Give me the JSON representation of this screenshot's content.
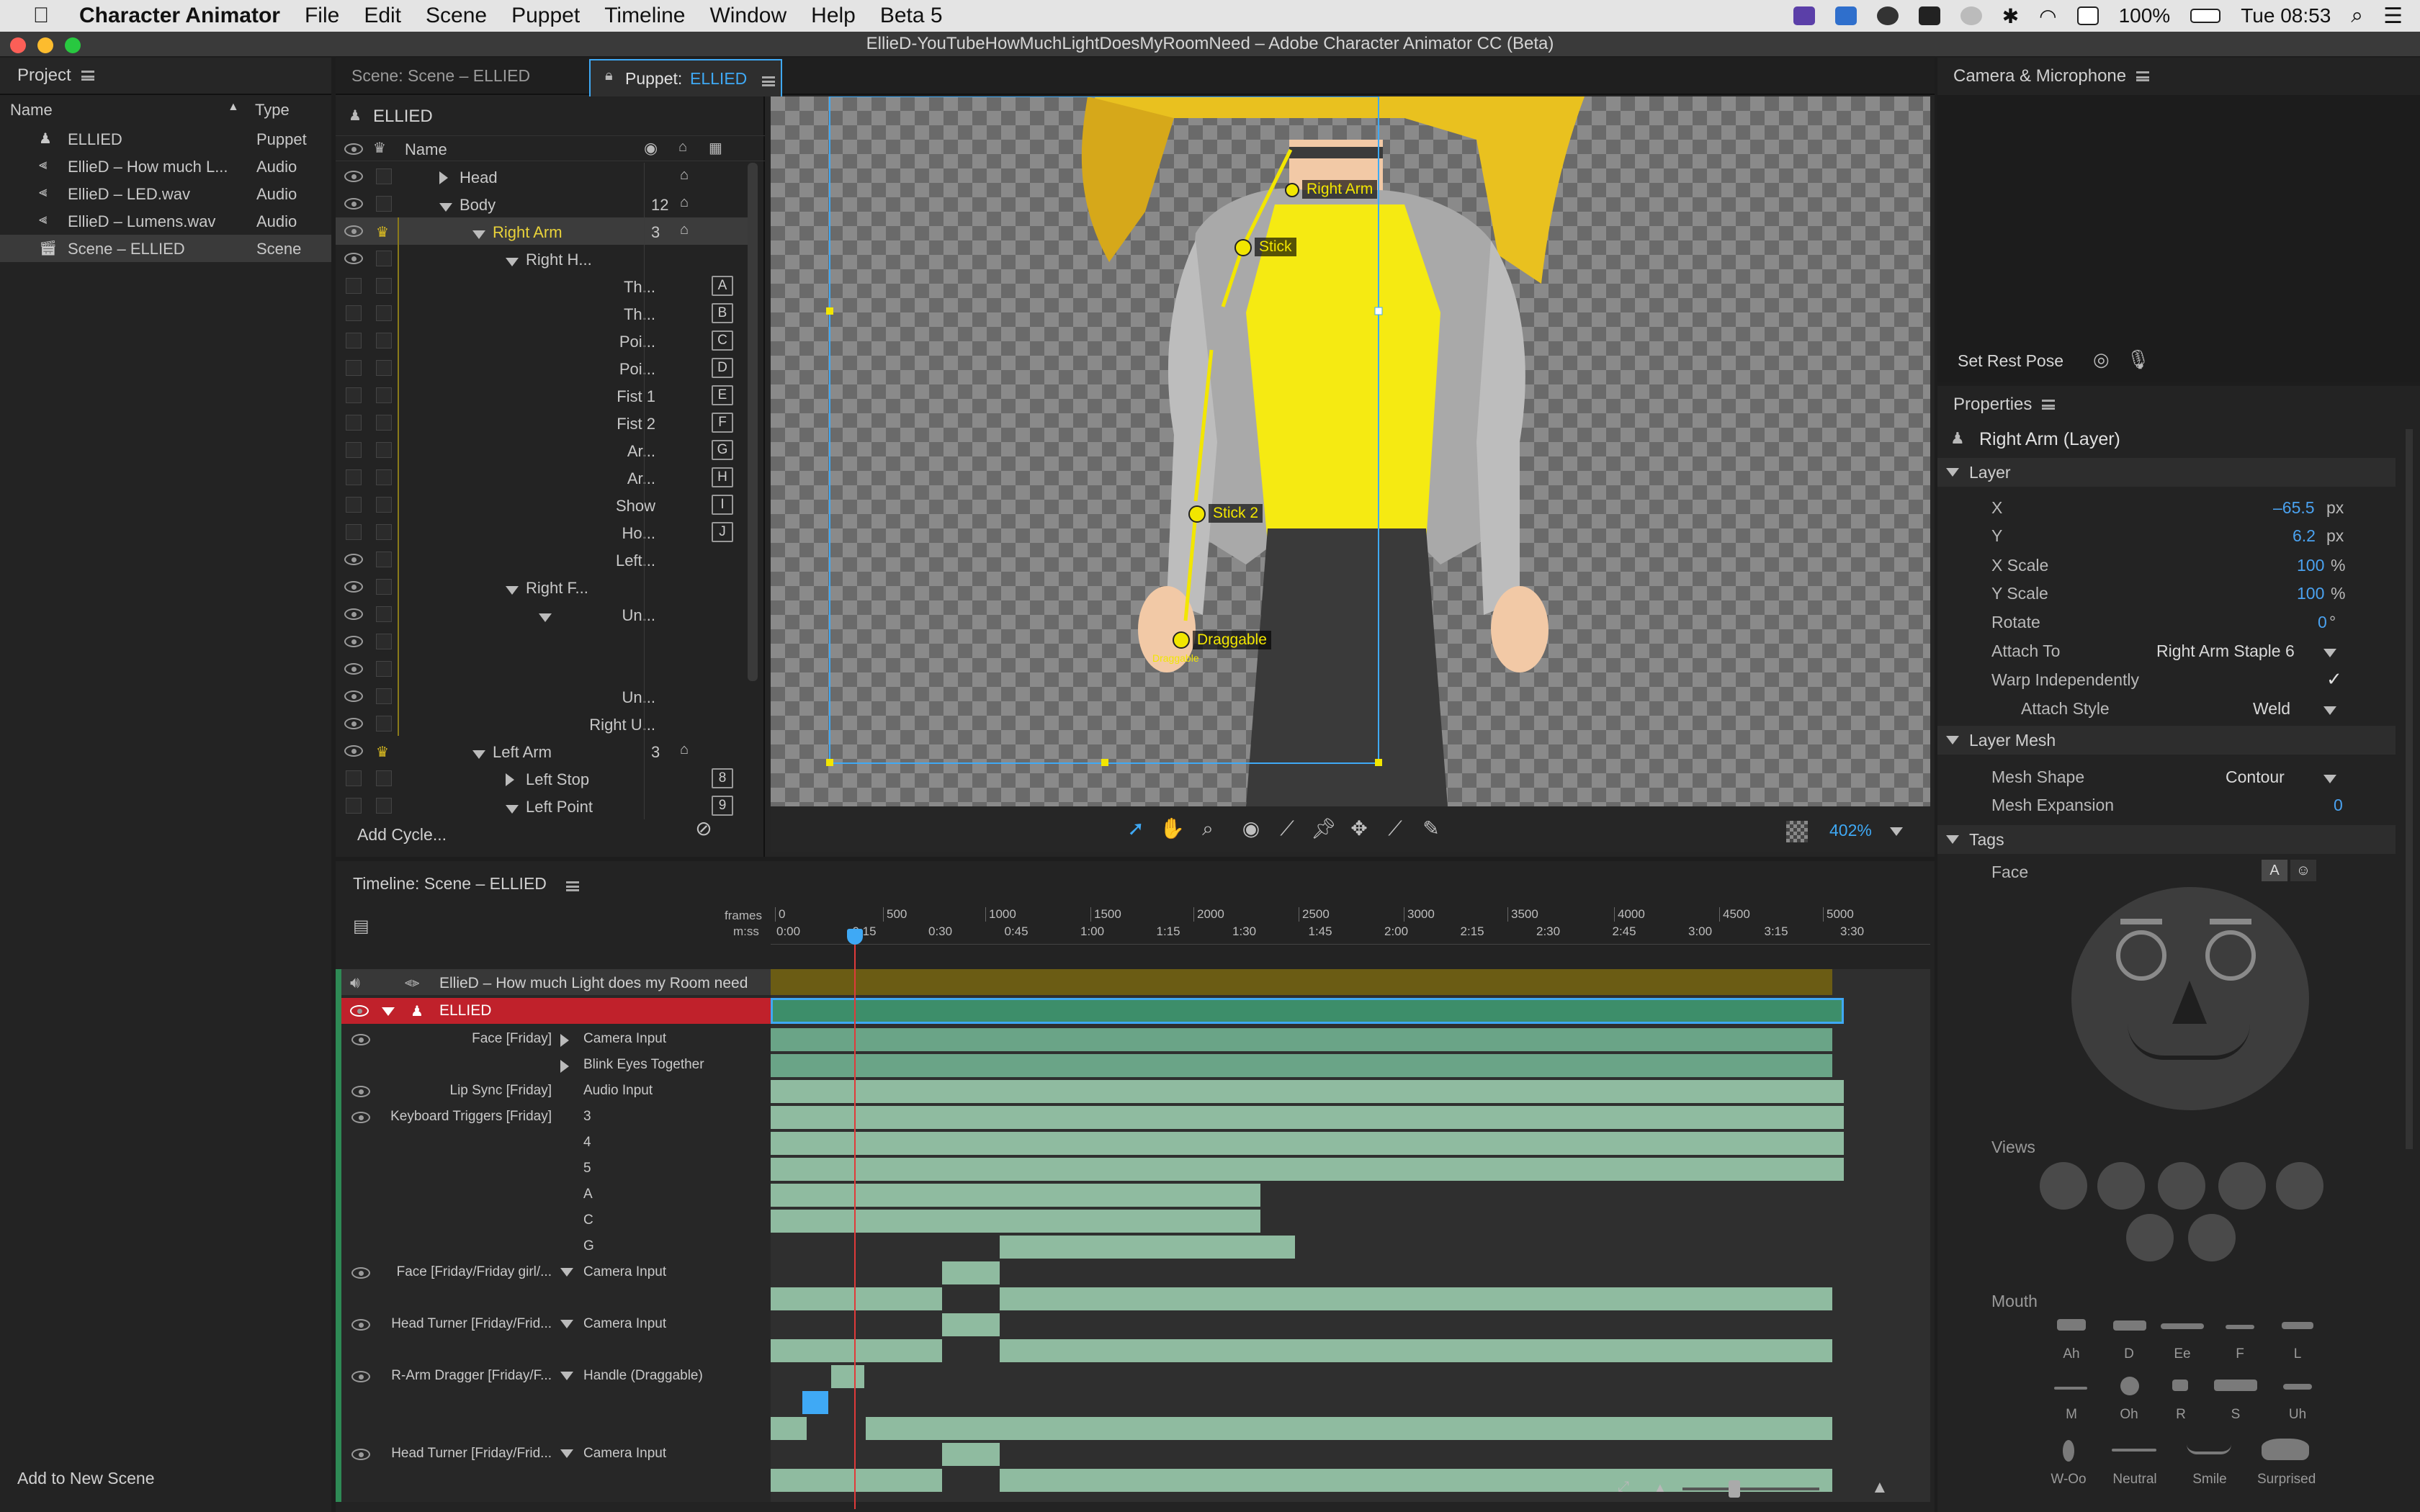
{
  "menubar": {
    "app_name": "Character Animator",
    "items": [
      "File",
      "Edit",
      "Scene",
      "Puppet",
      "Timeline",
      "Window",
      "Help",
      "Beta 5"
    ],
    "battery": "100%",
    "clock": "Tue 08:53"
  },
  "window_title": "EllieD-YouTubeHowMuchLightDoesMyRoomNeed – Adobe Character Animator CC (Beta)",
  "project": {
    "title": "Project",
    "col_name": "Name",
    "col_type": "Type",
    "items": [
      {
        "name": "ELLIED",
        "type": "Puppet",
        "icon": "puppet-icon"
      },
      {
        "name": "EllieD – How much L...",
        "type": "Audio",
        "icon": "audio-icon"
      },
      {
        "name": "EllieD – LED.wav",
        "type": "Audio",
        "icon": "audio-icon"
      },
      {
        "name": "EllieD – Lumens.wav",
        "type": "Audio",
        "icon": "audio-icon"
      },
      {
        "name": "Scene – ELLIED",
        "type": "Scene",
        "icon": "scene-icon"
      }
    ],
    "add_scene": "Add to New Scene"
  },
  "tabs": {
    "scene_tab": "Scene: Scene – ELLIED",
    "puppet_tab_prefix": "Puppet:",
    "puppet_tab_name": "ELLIED"
  },
  "puppet_tree": {
    "root": "ELLIED",
    "col_name": "Name",
    "rows": [
      {
        "label": "Head",
        "indent": 0,
        "arrow": "right",
        "value": "",
        "key": "",
        "eye": true
      },
      {
        "label": "Body",
        "indent": 0,
        "arrow": "down",
        "value": "12",
        "key": "",
        "eye": true
      },
      {
        "label": "Right Arm",
        "indent": 1,
        "arrow": "down",
        "value": "3",
        "key": "",
        "eye": true
      },
      {
        "label": "Right H...",
        "indent": 2,
        "arrow": "down",
        "value": "",
        "key": "",
        "eye": true
      },
      {
        "label": "Th...",
        "indent": 3,
        "arrow": "",
        "value": "",
        "key": "A",
        "eye": false
      },
      {
        "label": "Th...",
        "indent": 3,
        "arrow": "",
        "value": "",
        "key": "B",
        "eye": false
      },
      {
        "label": "Poi...",
        "indent": 3,
        "arrow": "",
        "value": "",
        "key": "C",
        "eye": false
      },
      {
        "label": "Poi...",
        "indent": 3,
        "arrow": "",
        "value": "",
        "key": "D",
        "eye": false
      },
      {
        "label": "Fist 1",
        "indent": 3,
        "arrow": "",
        "value": "",
        "key": "E",
        "eye": false
      },
      {
        "label": "Fist 2",
        "indent": 3,
        "arrow": "",
        "value": "",
        "key": "F",
        "eye": false
      },
      {
        "label": "Ar...",
        "indent": 3,
        "arrow": "",
        "value": "",
        "key": "G",
        "eye": false
      },
      {
        "label": "Ar...",
        "indent": 3,
        "arrow": "",
        "value": "",
        "key": "H",
        "eye": false
      },
      {
        "label": "Show",
        "indent": 3,
        "arrow": "",
        "value": "",
        "key": "I",
        "eye": false
      },
      {
        "label": "Ho...",
        "indent": 3,
        "arrow": "",
        "value": "",
        "key": "J",
        "eye": false
      },
      {
        "label": "Left...",
        "indent": 3,
        "arrow": "",
        "value": "",
        "key": "",
        "eye": true
      },
      {
        "label": "Right F...",
        "indent": 2,
        "arrow": "down",
        "value": "",
        "key": "",
        "eye": true
      },
      {
        "label": "Un...",
        "indent": 3,
        "arrow": "down",
        "value": "",
        "key": "",
        "eye": true
      },
      {
        "label": "",
        "indent": 3,
        "arrow": "",
        "value": "",
        "key": "",
        "eye": true
      },
      {
        "label": "",
        "indent": 3,
        "arrow": "",
        "value": "",
        "key": "",
        "eye": true
      },
      {
        "label": "Un...",
        "indent": 3,
        "arrow": "",
        "value": "",
        "key": "",
        "eye": true
      },
      {
        "label": "Right U...",
        "indent": 3,
        "arrow": "",
        "value": "",
        "key": "",
        "eye": true
      },
      {
        "label": "Left Arm",
        "indent": 1,
        "arrow": "down",
        "value": "3",
        "key": "",
        "eye": true
      },
      {
        "label": "Left Stop",
        "indent": 2,
        "arrow": "right",
        "value": "",
        "key": "8",
        "eye": false
      },
      {
        "label": "Left Point",
        "indent": 2,
        "arrow": "down",
        "value": "",
        "key": "9",
        "eye": false
      }
    ],
    "add_cycle": "Add Cycle..."
  },
  "canvas": {
    "handles": [
      "Right Arm",
      "Stick",
      "Stick 2",
      "Draggable"
    ],
    "draggable_sub": "Draggable",
    "zoom": "402%"
  },
  "camera": {
    "title": "Camera & Microphone",
    "set_rest_pose": "Set Rest Pose"
  },
  "properties": {
    "title": "Properties",
    "layer_title": "Right Arm (Layer)",
    "layer_section": "Layer",
    "x_label": "X",
    "x_value": "–65.5",
    "x_unit": "px",
    "y_label": "Y",
    "y_value": "6.2",
    "y_unit": "px",
    "xscale_label": "X Scale",
    "xscale_value": "100",
    "xscale_unit": "%",
    "yscale_label": "Y Scale",
    "yscale_value": "100",
    "yscale_unit": "%",
    "rotate_label": "Rotate",
    "rotate_value": "0",
    "rotate_unit": "°",
    "attach_to_label": "Attach To",
    "attach_to_value": "Right Arm Staple 6",
    "warp_label": "Warp Independently",
    "warp_check": "✓",
    "attach_style_label": "Attach Style",
    "attach_style_value": "Weld",
    "mesh_section": "Layer Mesh",
    "mesh_shape_label": "Mesh Shape",
    "mesh_shape_value": "Contour",
    "mesh_exp_label": "Mesh Expansion",
    "mesh_exp_value": "0",
    "tags_section": "Tags",
    "face_label": "Face",
    "face_btn": "A",
    "views_label": "Views",
    "mouth_label": "Mouth",
    "mouths": [
      "Ah",
      "D",
      "Ee",
      "F",
      "L",
      "M",
      "Oh",
      "R",
      "S",
      "Uh",
      "W-Oo",
      "Neutral",
      "Smile",
      "Surprised"
    ]
  },
  "timeline": {
    "title": "Timeline: Scene – ELLIED",
    "frames_label": "frames",
    "mss_label": "m:ss",
    "frame_ticks": [
      "0",
      "500",
      "1000",
      "1500",
      "2000",
      "2500",
      "3000",
      "3500",
      "4000",
      "4500",
      "5000"
    ],
    "time_ticks": [
      "0:00",
      "0:15",
      "0:30",
      "0:45",
      "1:00",
      "1:15",
      "1:30",
      "1:45",
      "2:00",
      "2:15",
      "2:30",
      "2:45",
      "3:00",
      "3:15",
      "3:30"
    ],
    "tracks": [
      {
        "a": "EllieD – How much Light does my Room need",
        "b": ""
      },
      {
        "a": "ELLIED",
        "b": ""
      },
      {
        "a": "Face [Friday]",
        "b": "Camera Input"
      },
      {
        "a": "",
        "b": "Blink Eyes Together"
      },
      {
        "a": "Lip Sync [Friday]",
        "b": "Audio Input"
      },
      {
        "a": "Keyboard Triggers [Friday]",
        "b": "3"
      },
      {
        "a": "",
        "b": "4"
      },
      {
        "a": "",
        "b": "5"
      },
      {
        "a": "",
        "b": "A"
      },
      {
        "a": "",
        "b": "C"
      },
      {
        "a": "",
        "b": "G"
      },
      {
        "a": "Face [Friday/Friday girl/...",
        "b": "Camera Input"
      },
      {
        "a": "Head Turner [Friday/Frid...",
        "b": "Camera Input"
      },
      {
        "a": "R-Arm Dragger [Friday/F...",
        "b": "Handle (Draggable)"
      },
      {
        "a": "Head Turner [Friday/Frid...",
        "b": "Camera Input"
      }
    ]
  },
  "colors": {
    "accent": "#3fa9f5",
    "track_green": "#8fbba0",
    "puppet_red": "#c0212b",
    "audio_olive": "#6b5c14",
    "handle_yellow": "#f2e600"
  }
}
